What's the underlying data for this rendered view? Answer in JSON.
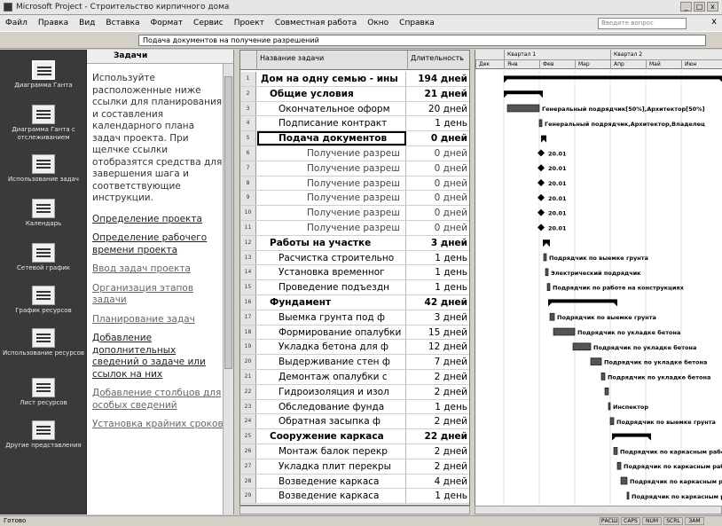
{
  "window": {
    "title": "Microsoft Project - Строительство кирпичного дома",
    "min_label": "_",
    "max_label": "□",
    "close_label": "x"
  },
  "menu": {
    "items": [
      "Файл",
      "Правка",
      "Вид",
      "Вставка",
      "Формат",
      "Сервис",
      "Проект",
      "Совместная работа",
      "Окно",
      "Справка"
    ],
    "help_placeholder": "Введите вопрос",
    "close_label": "x"
  },
  "entry_bar": {
    "value": "Подача документов на получение разрешений"
  },
  "view_bar": {
    "items": [
      {
        "label": "Диаграмма Ганта",
        "icon": "gantt-chart-icon"
      },
      {
        "label": "Диаграмма Ганта с отслеживанием",
        "icon": "tracking-gantt-icon"
      },
      {
        "label": "Использование задач",
        "icon": "task-usage-icon"
      },
      {
        "label": "Календарь",
        "icon": "calendar-icon"
      },
      {
        "label": "Сетевой график",
        "icon": "network-diagram-icon"
      },
      {
        "label": "График ресурсов",
        "icon": "resource-graph-icon"
      },
      {
        "label": "Использование ресурсов",
        "icon": "resource-usage-icon"
      },
      {
        "label": "Лист ресурсов",
        "icon": "resource-sheet-icon"
      },
      {
        "label": "Другие представления",
        "icon": "more-views-icon"
      }
    ]
  },
  "task_pane": {
    "title": "Задачи",
    "intro": "Используйте расположенные ниже ссылки для планирования и составления календарного плана задач проекта. При щелчке ссылки отобразятся средства для завершения шага и соответствующие инструкции.",
    "links": [
      "Определение проекта",
      "Определение рабочего времени проекта",
      "Ввод задач проекта",
      "Организация этапов задачи",
      "Планирование задач",
      "Добавление дополнительных сведений о задаче или ссылок на них",
      "Добавление столбцов для особых сведений",
      "Установка крайних сроков"
    ]
  },
  "grid": {
    "header_name": "Название задачи",
    "header_duration": "Длительность",
    "rows": [
      {
        "num": "1",
        "name": "Дом на одну семью - ины",
        "duration": "194 дней",
        "level": 0,
        "summary": true
      },
      {
        "num": "2",
        "name": "Общие условия",
        "duration": "21 дней",
        "level": 1,
        "summary": true
      },
      {
        "num": "3",
        "name": "Окончательное оформ",
        "duration": "20 дней",
        "level": 2,
        "summary": false
      },
      {
        "num": "4",
        "name": "Подписание контракт",
        "duration": "1 день",
        "level": 2,
        "summary": false
      },
      {
        "num": "5",
        "name": "Подача документов",
        "duration": "0 дней",
        "level": 2,
        "summary": true,
        "selected": true
      },
      {
        "num": "6",
        "name": "Получение разреш",
        "duration": "0 дней",
        "level": 3,
        "summary": false
      },
      {
        "num": "7",
        "name": "Получение разреш",
        "duration": "0 дней",
        "level": 3,
        "summary": false
      },
      {
        "num": "8",
        "name": "Получение разреш",
        "duration": "0 дней",
        "level": 3,
        "summary": false
      },
      {
        "num": "9",
        "name": "Получение разреш",
        "duration": "0 дней",
        "level": 3,
        "summary": false
      },
      {
        "num": "10",
        "name": "Получение разреш",
        "duration": "0 дней",
        "level": 3,
        "summary": false
      },
      {
        "num": "11",
        "name": "Получение разреш",
        "duration": "0 дней",
        "level": 3,
        "summary": false
      },
      {
        "num": "12",
        "name": "Работы на участке",
        "duration": "3 дней",
        "level": 1,
        "summary": true
      },
      {
        "num": "13",
        "name": "Расчистка строительно",
        "duration": "1 день",
        "level": 2,
        "summary": false
      },
      {
        "num": "14",
        "name": "Установка временног",
        "duration": "1 день",
        "level": 2,
        "summary": false
      },
      {
        "num": "15",
        "name": "Проведение подъездн",
        "duration": "1 день",
        "level": 2,
        "summary": false
      },
      {
        "num": "16",
        "name": "Фундамент",
        "duration": "42 дней",
        "level": 1,
        "summary": true
      },
      {
        "num": "17",
        "name": "Выемка грунта под ф",
        "duration": "3 дней",
        "level": 2,
        "summary": false
      },
      {
        "num": "18",
        "name": "Формирование опалубки",
        "duration": "15 дней",
        "level": 2,
        "summary": false
      },
      {
        "num": "19",
        "name": "Укладка бетона для ф",
        "duration": "12 дней",
        "level": 2,
        "summary": false
      },
      {
        "num": "20",
        "name": "Выдерживание стен ф",
        "duration": "7 дней",
        "level": 2,
        "summary": false
      },
      {
        "num": "21",
        "name": "Демонтаж опалубки с",
        "duration": "2 дней",
        "level": 2,
        "summary": false
      },
      {
        "num": "22",
        "name": "Гидроизоляция и изол",
        "duration": "2 дней",
        "level": 2,
        "summary": false
      },
      {
        "num": "23",
        "name": "Обследование фунда",
        "duration": "1 день",
        "level": 2,
        "summary": false
      },
      {
        "num": "24",
        "name": "Обратная засыпка ф",
        "duration": "2 дней",
        "level": 2,
        "summary": false
      },
      {
        "num": "25",
        "name": "Сооружение каркаса",
        "duration": "22 дней",
        "level": 1,
        "summary": true
      },
      {
        "num": "26",
        "name": "Монтаж балок перекр",
        "duration": "2 дней",
        "level": 2,
        "summary": false
      },
      {
        "num": "27",
        "name": "Укладка плит перекры",
        "duration": "2 дней",
        "level": 2,
        "summary": false
      },
      {
        "num": "28",
        "name": "Возведение каркаса",
        "duration": "4 дней",
        "level": 2,
        "summary": false
      },
      {
        "num": "29",
        "name": "Возведение каркаса",
        "duration": "1 день",
        "level": 2,
        "summary": false
      }
    ]
  },
  "gantt": {
    "timescale_top": [
      "Квартал 1",
      "Квартал 2"
    ],
    "timescale_bottom": [
      "Дек",
      "Янв",
      "Фев",
      "Мар",
      "Апр",
      "Май",
      "Июн"
    ],
    "bar_labels": [
      "Генеральный подрядчик[50%],Архитектор[50%]",
      "Генеральный подрядчик,Архитектор,Владелец",
      "20.01",
      "20.01",
      "20.01",
      "20.01",
      "20.01",
      "20.01",
      "Подрядчик по выемке грунта",
      "Электрический подрядчик",
      "Подрядчик по работе на конструкциях",
      "Подрядчик по выемке грунта",
      "Подрядчик по укладке бетона",
      "Подрядчик по укладке бетона",
      "Подрядчик по укладке бетона",
      "Подрядчик по укладке бетона",
      "Инспектор",
      "Подрядчик по выемке грунта",
      "Подрядчик по каркасным работам",
      "Подрядчик по каркасным работам",
      "Подрядчик по каркасным работам",
      "Подрядчик по каркасным работам"
    ]
  },
  "status_bar": {
    "left": "Готово",
    "indicators": [
      "РАСШ",
      "CAPS",
      "NUM",
      "SCRL",
      "ЗАМ"
    ]
  }
}
